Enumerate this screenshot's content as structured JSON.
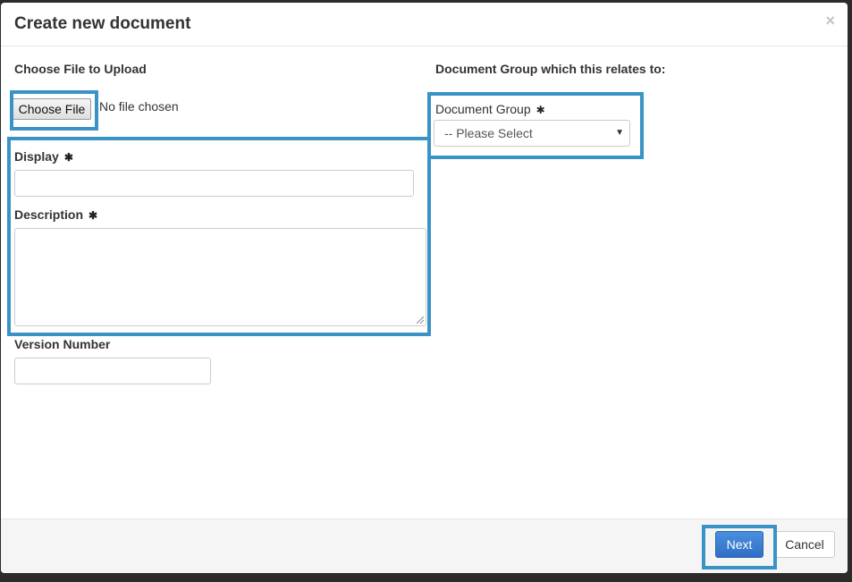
{
  "modal": {
    "title": "Create new document",
    "close_glyph": "×"
  },
  "upload": {
    "section_label": "Choose File to Upload",
    "button_label": "Choose File",
    "status": "No file chosen"
  },
  "fields": {
    "display_label": "Display",
    "display_value": "",
    "description_label": "Description",
    "description_value": "",
    "version_label": "Version Number",
    "version_value": "",
    "required_glyph": "✱"
  },
  "group": {
    "section_label": "Document Group which this relates to:",
    "field_label": "Document Group",
    "selected": "-- Please Select",
    "caret": "▼"
  },
  "footer": {
    "next_label": "Next",
    "cancel_label": "Cancel"
  },
  "colors": {
    "highlight": "#3a93c6",
    "primary": "#337ab7"
  }
}
